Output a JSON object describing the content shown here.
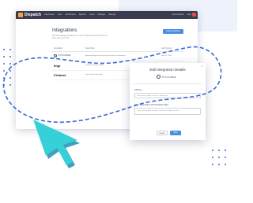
{
  "app": {
    "name": "Dispatch",
    "nav_items": [
      "Dashboard",
      "Jobs",
      "Technicians",
      "Reports",
      "Users",
      "Manage",
      "Settings"
    ],
    "right_nav": [
      "Administrator",
      "Help"
    ]
  },
  "page": {
    "title": "Integrations",
    "description": "Add and manage integrations to connect Dispatch with the tools your team uses every day.",
    "add_button": "Add Integration"
  },
  "table": {
    "headers": [
      "Integration",
      "Description",
      "Last Synced"
    ],
    "rows": [
      {
        "name": "STICKABLE",
        "description": "Automatically track and review customer interactions.",
        "status": "Sep 12, 2019"
      },
      {
        "name": "Imgr",
        "description": "Generate image reports.",
        "status": "Sep 10, 2019"
      },
      {
        "name": "Fieldnet",
        "description": "Sync field activity data.",
        "status": "Aug 28, 2019"
      }
    ]
  },
  "modal": {
    "close": "×",
    "title": "Edit Integration Details",
    "brand": "STICKABLE",
    "api_key_label": "API Key",
    "api_key_value": "Lorem ipsum dolor sit amet, consectetur",
    "short_desc_label": "Short Description (50 Character Max)",
    "short_desc_value": "Lorem ipsum dolor sit amet, consectetur adipiscing elit",
    "cancel": "Cancel",
    "save": "Save"
  },
  "colors": {
    "accent": "#4a8de2",
    "topbar": "#3b3b4f",
    "arrow": "#35d0d8",
    "dash": "#3a6ad4"
  },
  "icons": {
    "cursor": "cursor-arrow-icon",
    "logo": "dispatch-logo-icon"
  }
}
